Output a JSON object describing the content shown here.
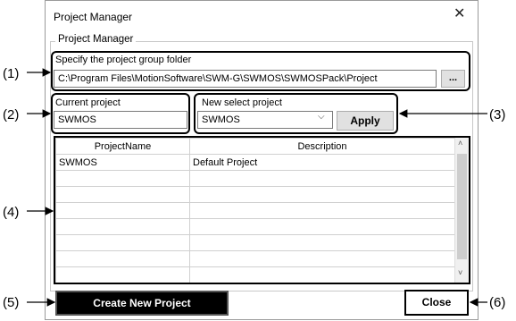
{
  "window": {
    "title": "Project Manager"
  },
  "group": {
    "label": "Project Manager"
  },
  "folder": {
    "label": "Specify the project group folder",
    "path": "C:\\Program Files\\MotionSoftware\\SWM-G\\SWMOS\\SWMOSPack\\Project",
    "browse_label": "..."
  },
  "current": {
    "label": "Current project",
    "value": "SWMOS"
  },
  "new_select": {
    "label": "New select project",
    "value": "SWMOS",
    "apply_label": "Apply"
  },
  "table": {
    "columns": [
      "ProjectName",
      "Description"
    ],
    "rows": [
      [
        "SWMOS",
        "Default Project"
      ],
      [
        "",
        ""
      ],
      [
        "",
        ""
      ],
      [
        "",
        ""
      ],
      [
        "",
        ""
      ],
      [
        "",
        ""
      ],
      [
        "",
        ""
      ],
      [
        "",
        ""
      ]
    ]
  },
  "buttons": {
    "create_label": "Create New Project",
    "close_label": "Close"
  },
  "callouts": [
    "(1)",
    "(2)",
    "(3)",
    "(4)",
    "(5)",
    "(6)"
  ]
}
